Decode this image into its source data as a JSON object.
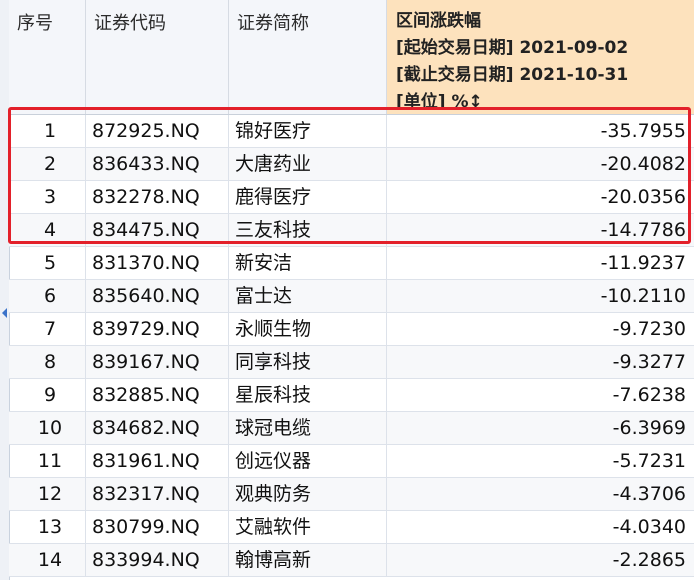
{
  "table": {
    "headers": {
      "index": "序号",
      "code": "证券代码",
      "name": "证券简称",
      "change": {
        "line1": "区间涨跌幅",
        "line2": "[起始交易日期] 2021-09-02",
        "line3": "[截止交易日期] 2021-10-31",
        "line4": "[单位] %↕"
      }
    },
    "rows": [
      {
        "index": "1",
        "code": "872925.NQ",
        "name": "锦好医疗",
        "change": "-35.7955"
      },
      {
        "index": "2",
        "code": "836433.NQ",
        "name": "大唐药业",
        "change": "-20.4082"
      },
      {
        "index": "3",
        "code": "832278.NQ",
        "name": "鹿得医疗",
        "change": "-20.0356"
      },
      {
        "index": "4",
        "code": "834475.NQ",
        "name": "三友科技",
        "change": "-14.7786"
      },
      {
        "index": "5",
        "code": "831370.NQ",
        "name": "新安洁",
        "change": "-11.9237"
      },
      {
        "index": "6",
        "code": "835640.NQ",
        "name": "富士达",
        "change": "-10.2110"
      },
      {
        "index": "7",
        "code": "839729.NQ",
        "name": "永顺生物",
        "change": "-9.7230"
      },
      {
        "index": "8",
        "code": "839167.NQ",
        "name": "同享科技",
        "change": "-9.3277"
      },
      {
        "index": "9",
        "code": "832885.NQ",
        "name": "星辰科技",
        "change": "-7.6238"
      },
      {
        "index": "10",
        "code": "834682.NQ",
        "name": "球冠电缆",
        "change": "-6.3969"
      },
      {
        "index": "11",
        "code": "831961.NQ",
        "name": "创远仪器",
        "change": "-5.7231"
      },
      {
        "index": "12",
        "code": "832317.NQ",
        "name": "观典防务",
        "change": "-4.3706"
      },
      {
        "index": "13",
        "code": "830799.NQ",
        "name": "艾融软件",
        "change": "-4.0340"
      },
      {
        "index": "14",
        "code": "833994.NQ",
        "name": "翰博高新",
        "change": "-2.2865"
      }
    ]
  },
  "colors": {
    "header_bg": "#f4f6fa",
    "change_header_bg": "#fde2bd",
    "highlight_border": "#e3202a",
    "scroll_arrow": "#3b73c9"
  }
}
